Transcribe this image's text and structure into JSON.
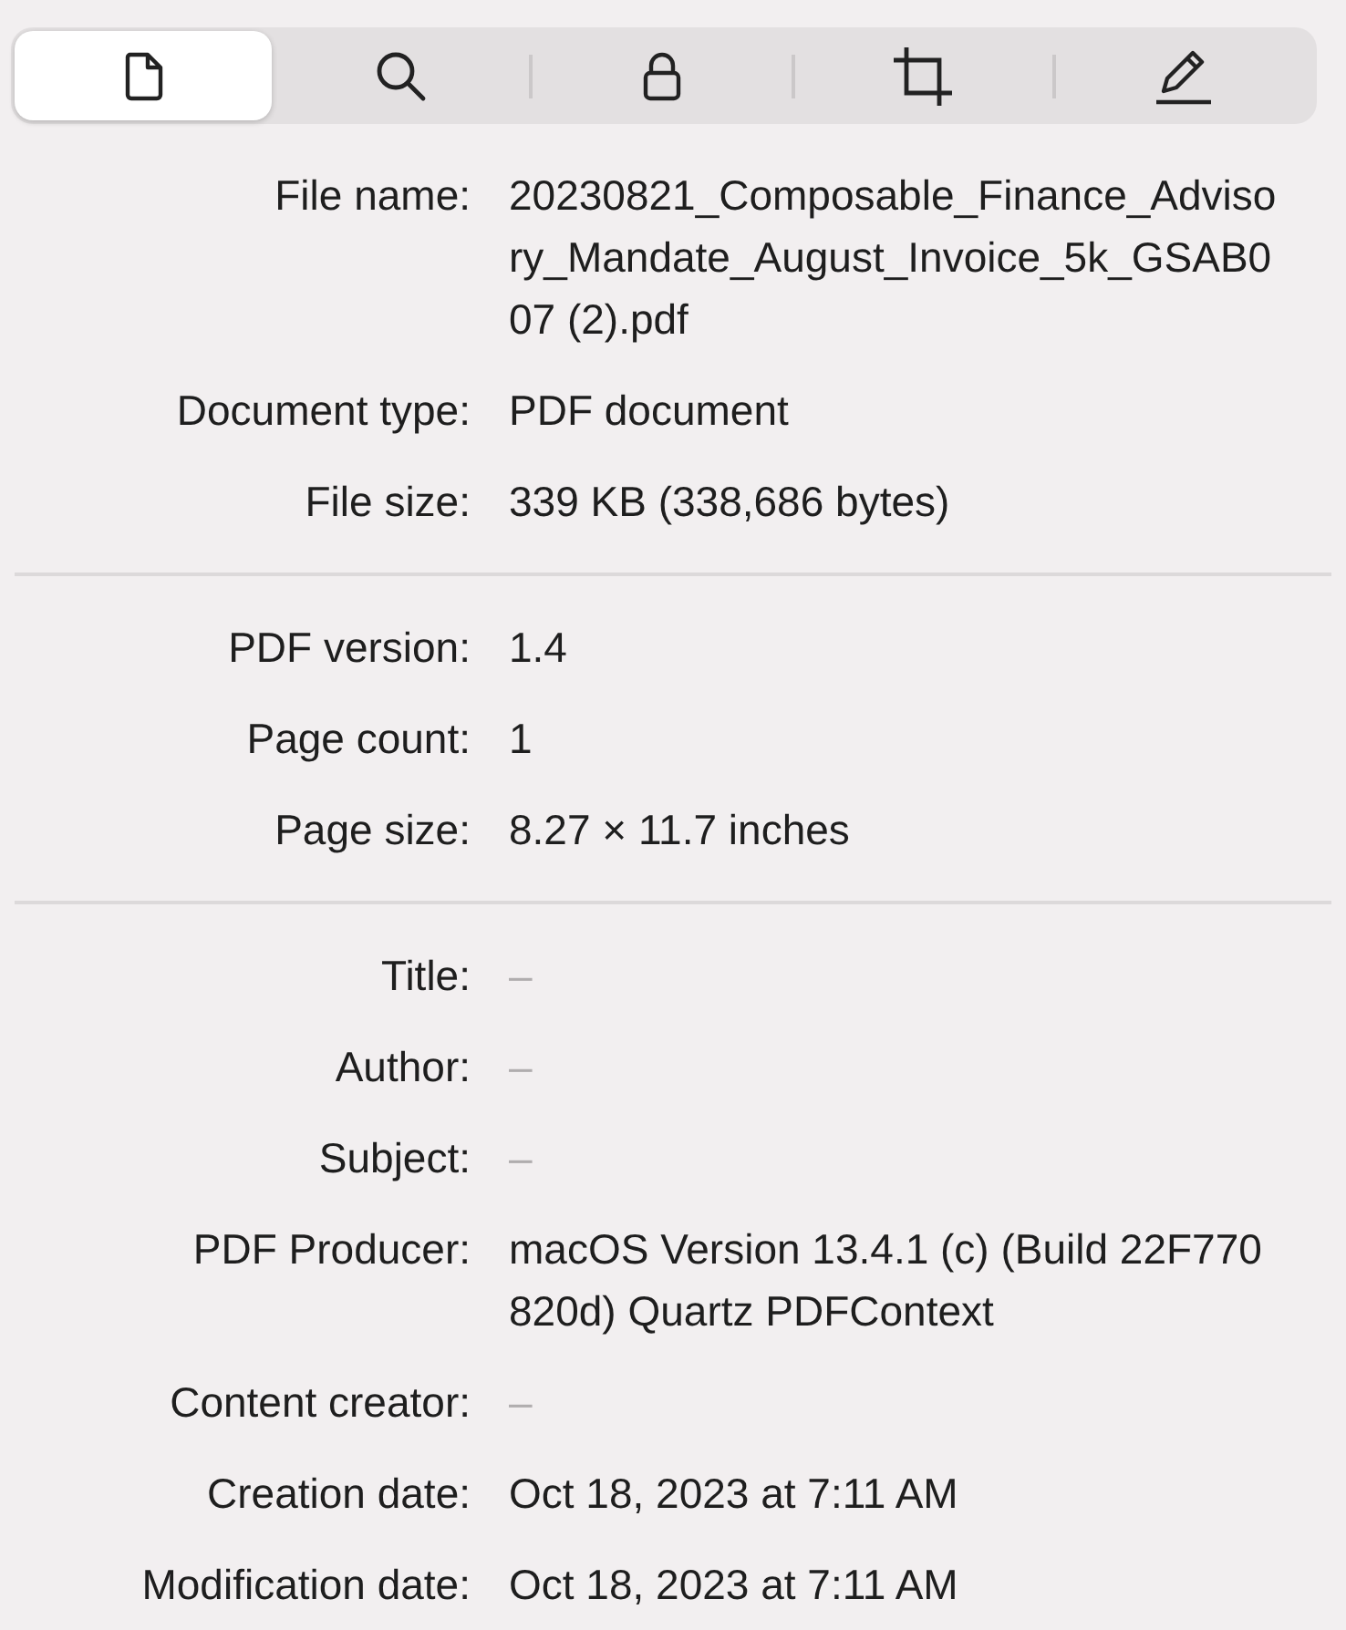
{
  "tabs": [
    {
      "kind": "document",
      "selected": true
    },
    {
      "kind": "search",
      "selected": false
    },
    {
      "kind": "lock",
      "selected": false
    },
    {
      "kind": "crop",
      "selected": false
    },
    {
      "kind": "pencil",
      "selected": false
    }
  ],
  "sections": [
    {
      "rows": [
        {
          "label": "File name:",
          "value": "20230821_Composable_Finance_Advisory_Mandate_August_Invoice_5k_GSAB007 (2).pdf",
          "dimmed": false
        },
        {
          "label": "Document type:",
          "value": "PDF document",
          "dimmed": false
        },
        {
          "label": "File size:",
          "value": "339 KB (338,686 bytes)",
          "dimmed": false
        }
      ]
    },
    {
      "rows": [
        {
          "label": "PDF version:",
          "value": "1.4",
          "dimmed": false
        },
        {
          "label": "Page count:",
          "value": "1",
          "dimmed": false
        },
        {
          "label": "Page size:",
          "value": "8.27 × 11.7 inches",
          "dimmed": false
        }
      ]
    },
    {
      "rows": [
        {
          "label": "Title:",
          "value": "–",
          "dimmed": true
        },
        {
          "label": "Author:",
          "value": "–",
          "dimmed": true
        },
        {
          "label": "Subject:",
          "value": "–",
          "dimmed": true
        },
        {
          "label": "PDF Producer:",
          "value": "macOS Version 13.4.1 (c) (Build 22F770820d) Quartz PDFContext",
          "dimmed": false
        },
        {
          "label": "Content creator:",
          "value": "–",
          "dimmed": true
        },
        {
          "label": "Creation date:",
          "value": "Oct 18, 2023 at 7:11 AM",
          "dimmed": false
        },
        {
          "label": "Modification date:",
          "value": "Oct 18, 2023 at 7:11 AM",
          "dimmed": false
        }
      ]
    }
  ]
}
